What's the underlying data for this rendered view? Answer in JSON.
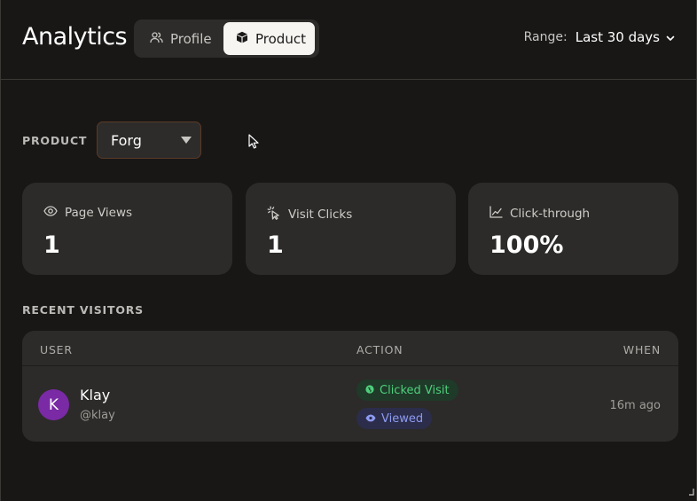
{
  "header": {
    "title": "Analytics",
    "tabs": [
      {
        "label": "Profile",
        "icon": "users-icon",
        "active": false
      },
      {
        "label": "Product",
        "icon": "box-icon",
        "active": true
      }
    ],
    "range": {
      "label": "Range:",
      "value": "Last 30 days"
    }
  },
  "filter": {
    "label": "PRODUCT",
    "selected": "Forg"
  },
  "stats": [
    {
      "label": "Page Views",
      "value": "1",
      "icon": "eye-icon"
    },
    {
      "label": "Visit Clicks",
      "value": "1",
      "icon": "pointer-click-icon"
    },
    {
      "label": "Click-through",
      "value": "100%",
      "icon": "trend-chart-icon"
    }
  ],
  "visitors": {
    "title": "RECENT VISITORS",
    "columns": {
      "user": "USER",
      "action": "ACTION",
      "when": "WHEN"
    },
    "rows": [
      {
        "initial": "K",
        "name": "Klay",
        "handle": "@klay",
        "actions": [
          {
            "label": "Clicked Visit",
            "icon": "globe-icon"
          },
          {
            "label": "Viewed",
            "icon": "eye-icon"
          }
        ],
        "when": "16m ago"
      }
    ]
  },
  "colors": {
    "background": "#181716",
    "card": "#2c2b29",
    "active_tab": "#f7f5f2",
    "avatar": "#7a2aa5",
    "clicked_badge": "#4fcf7c",
    "viewed_badge": "#8e9bf2",
    "select_border": "#5b3a26"
  }
}
